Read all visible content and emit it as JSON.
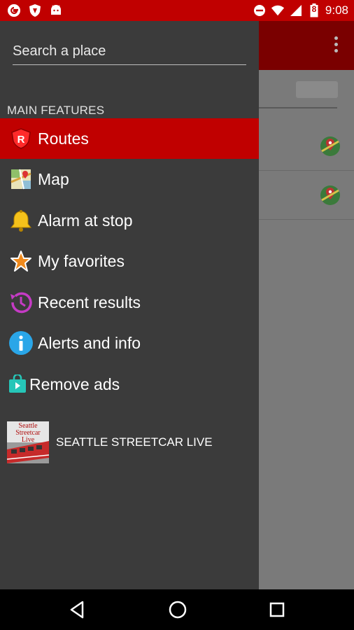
{
  "status_bar": {
    "time": "9:08",
    "battery_level": "8",
    "icons": [
      "google-icon",
      "shield-icon",
      "android-icon",
      "do-not-disturb-icon",
      "wifi-icon",
      "signal-icon",
      "battery-icon"
    ]
  },
  "drawer": {
    "search_placeholder": "Search a place",
    "section_title": "MAIN FEATURES",
    "items": [
      {
        "label": "Routes",
        "icon": "routes-shield-icon",
        "active": true
      },
      {
        "label": "Map",
        "icon": "map-icon",
        "active": false
      },
      {
        "label": "Alarm at stop",
        "icon": "bell-icon",
        "active": false
      },
      {
        "label": "My favorites",
        "icon": "star-icon",
        "active": false
      },
      {
        "label": "Recent results",
        "icon": "history-icon",
        "active": false
      },
      {
        "label": "Alerts and info",
        "icon": "info-icon",
        "active": false
      },
      {
        "label": "Remove ads",
        "icon": "shopping-bag-icon",
        "active": false
      }
    ],
    "promo": {
      "label": "SEATTLE STREETCAR LIVE",
      "image_text": "Seattle Streetcar Live"
    }
  },
  "colors": {
    "accent": "#c00000",
    "drawer_bg": "#3b3b3b",
    "appbar_dark": "#7a0000"
  },
  "nav_bar": {
    "buttons": [
      "back-icon",
      "home-icon",
      "recents-icon"
    ]
  }
}
